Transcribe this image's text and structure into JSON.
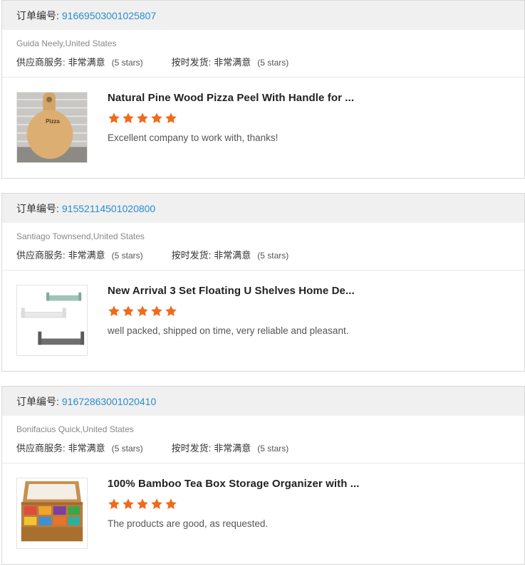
{
  "order_label": "订单编号:",
  "supplier_service_label": "供应商服务:",
  "on_time_label": "按时发货:",
  "colors": {
    "accent_link": "#2a8bd0",
    "star": "#f06a1b",
    "header_bg": "#f0f0f0"
  },
  "reviews": [
    {
      "order_number": "91669503001025807",
      "buyer": "Guida Neely,United States",
      "supplier_service": {
        "value": "非常满意",
        "stars_text": "(5 stars)"
      },
      "on_time": {
        "value": "非常满意",
        "stars_text": "(5 stars)"
      },
      "product_title": "Natural Pine Wood Pizza Peel With Handle for ...",
      "rating": 5,
      "comment": "Excellent company to work with, thanks!",
      "thumbnail_icon": "pizza-peel-image"
    },
    {
      "order_number": "91552114501020800",
      "buyer": "Santiago Townsend,United States",
      "supplier_service": {
        "value": "非常满意",
        "stars_text": "(5 stars)"
      },
      "on_time": {
        "value": "非常满意",
        "stars_text": "(5 stars)"
      },
      "product_title": "New Arrival 3 Set Floating U Shelves Home De...",
      "rating": 5,
      "comment": "well packed, shipped on time, very reliable and pleasant.",
      "thumbnail_icon": "floating-shelves-image"
    },
    {
      "order_number": "91672863001020410",
      "buyer": "Bonifacius Quick,United States",
      "supplier_service": {
        "value": "非常满意",
        "stars_text": "(5 stars)"
      },
      "on_time": {
        "value": "非常满意",
        "stars_text": "(5 stars)"
      },
      "product_title": "100% Bamboo Tea Box Storage Organizer with ...",
      "rating": 5,
      "comment": "The products are good, as requested.",
      "thumbnail_icon": "tea-box-image"
    }
  ]
}
